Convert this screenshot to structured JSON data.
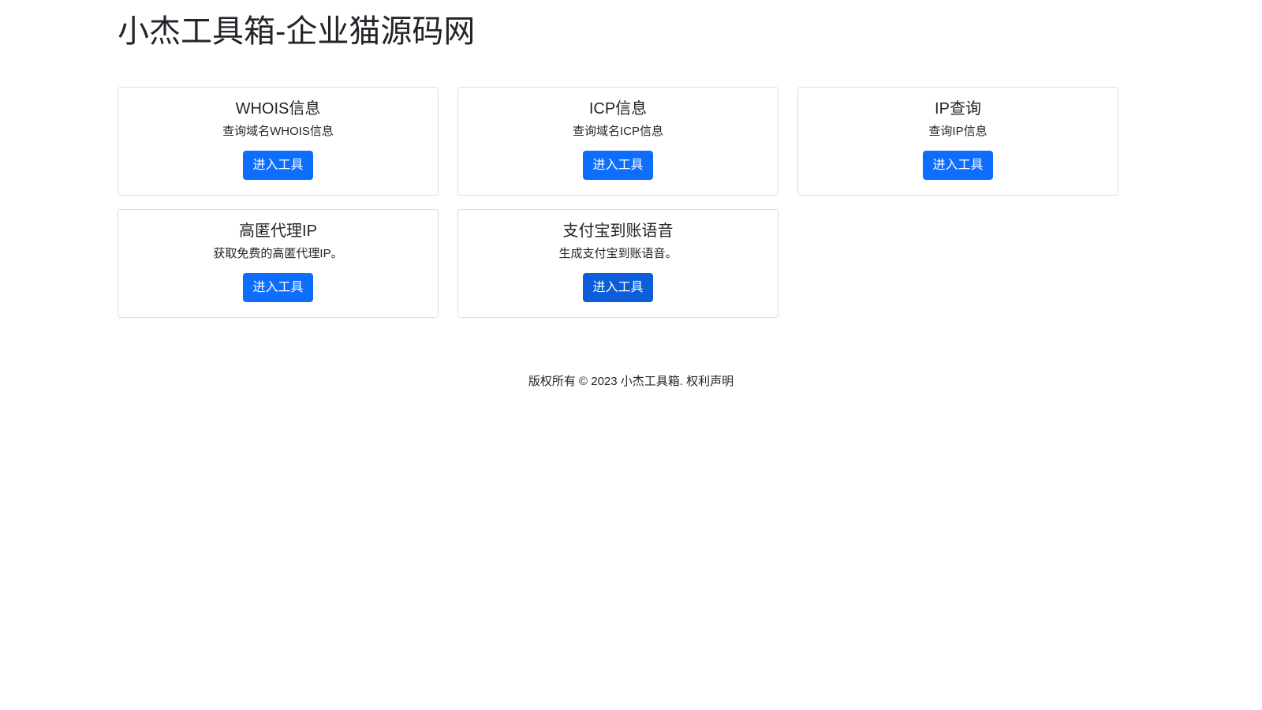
{
  "header": {
    "title": "小杰工具箱-企业猫源码网"
  },
  "tools": [
    {
      "title": "WHOIS信息",
      "desc": "查询域名WHOIS信息",
      "button": "进入工具"
    },
    {
      "title": "ICP信息",
      "desc": "查询域名ICP信息",
      "button": "进入工具"
    },
    {
      "title": "IP查询",
      "desc": "查询IP信息",
      "button": "进入工具"
    },
    {
      "title": "高匿代理IP",
      "desc": "获取免费的高匿代理IP。",
      "button": "进入工具"
    },
    {
      "title": "支付宝到账语音",
      "desc": "生成支付宝到账语音。",
      "button": "进入工具"
    }
  ],
  "footer": {
    "text": "版权所有 © 2023 小杰工具箱. 权利声明"
  },
  "colors": {
    "primary": "#0d6efd",
    "primary_hover": "#0b5ed7"
  }
}
